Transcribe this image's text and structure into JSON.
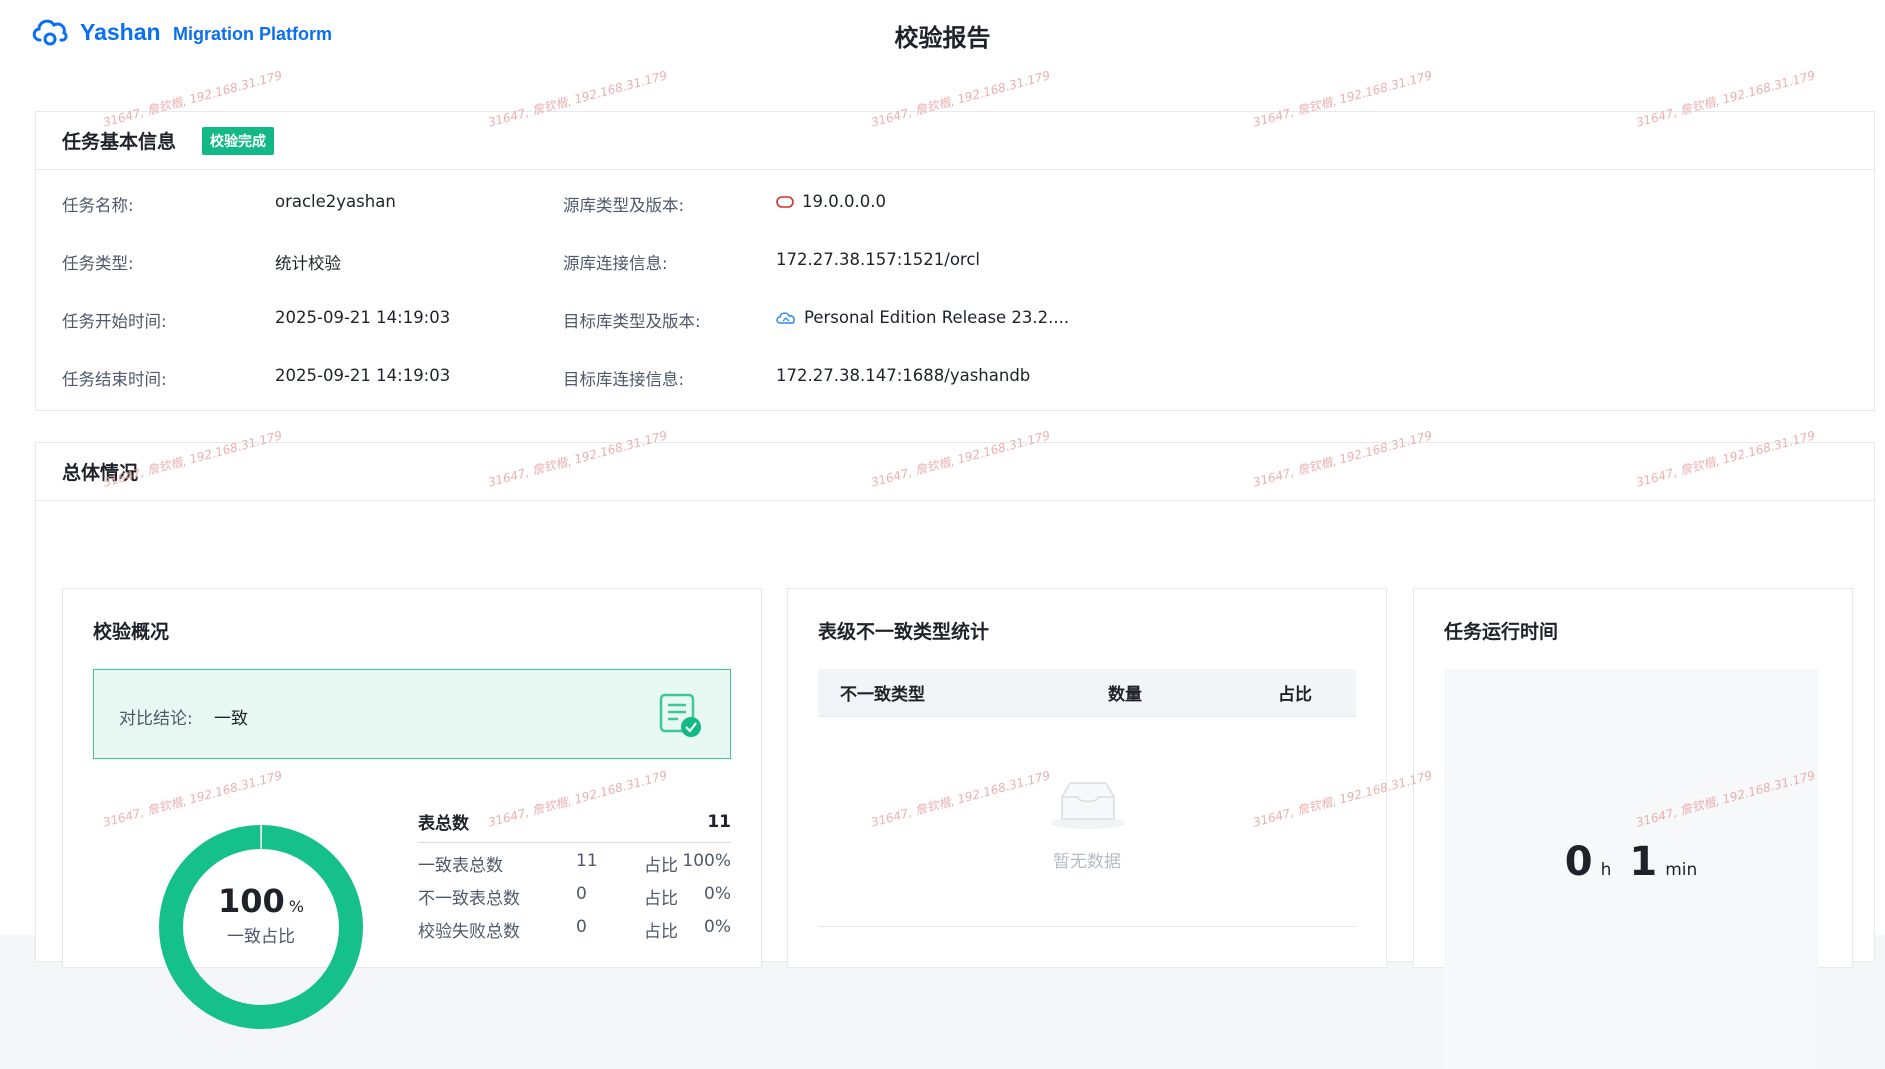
{
  "header": {
    "brand_name": "Yashan",
    "brand_sub": "Migration Platform",
    "page_title": "校验报告"
  },
  "basic_info": {
    "title": "任务基本信息",
    "status_badge": "校验完成",
    "fields": [
      {
        "label": "任务名称:",
        "value": "oracle2yashan"
      },
      {
        "label": "任务类型:",
        "value": "统计校验"
      },
      {
        "label": "任务开始时间:",
        "value": "2025-09-21 14:19:03"
      },
      {
        "label": "任务结束时间:",
        "value": "2025-09-21 14:19:03"
      }
    ],
    "db_fields": [
      {
        "label": "源库类型及版本:",
        "value": "19.0.0.0.0",
        "icon": "oracle-db-icon"
      },
      {
        "label": "源库连接信息:",
        "value": "172.27.38.157:1521/orcl"
      },
      {
        "label": "目标库类型及版本:",
        "value": "Personal Edition Release 23.2....",
        "icon": "yashan-db-icon"
      },
      {
        "label": "目标库连接信息:",
        "value": "172.27.38.147:1688/yashandb"
      }
    ]
  },
  "overview": {
    "title": "总体情况",
    "verify_summary": {
      "title": "校验概况",
      "conclusion_label": "对比结论:",
      "conclusion_value": "一致",
      "consistent_percent": 100,
      "percent_number": "100",
      "percent_unit": "%",
      "percent_caption": "一致占比",
      "total_label": "表总数",
      "total_value": "11",
      "rows": [
        {
          "name": "一致表总数",
          "count": "11",
          "ratio_label": "占比",
          "ratio": "100%"
        },
        {
          "name": "不一致表总数",
          "count": "0",
          "ratio_label": "占比",
          "ratio": "0%"
        },
        {
          "name": "校验失败总数",
          "count": "0",
          "ratio_label": "占比",
          "ratio": "0%"
        }
      ]
    },
    "inconsistency_stats": {
      "title": "表级不一致类型统计",
      "columns": [
        "不一致类型",
        "数量",
        "占比"
      ],
      "empty_text": "暂无数据"
    },
    "runtime": {
      "title": "任务运行时间",
      "hours": "0",
      "hours_unit": "h",
      "minutes": "1",
      "minutes_unit": "min"
    }
  },
  "watermark": "31647, 詹钦楷, 192.168.31.179",
  "colors": {
    "brand": "#0a6ff0",
    "success": "#12b886",
    "donut": "#15c08a"
  }
}
